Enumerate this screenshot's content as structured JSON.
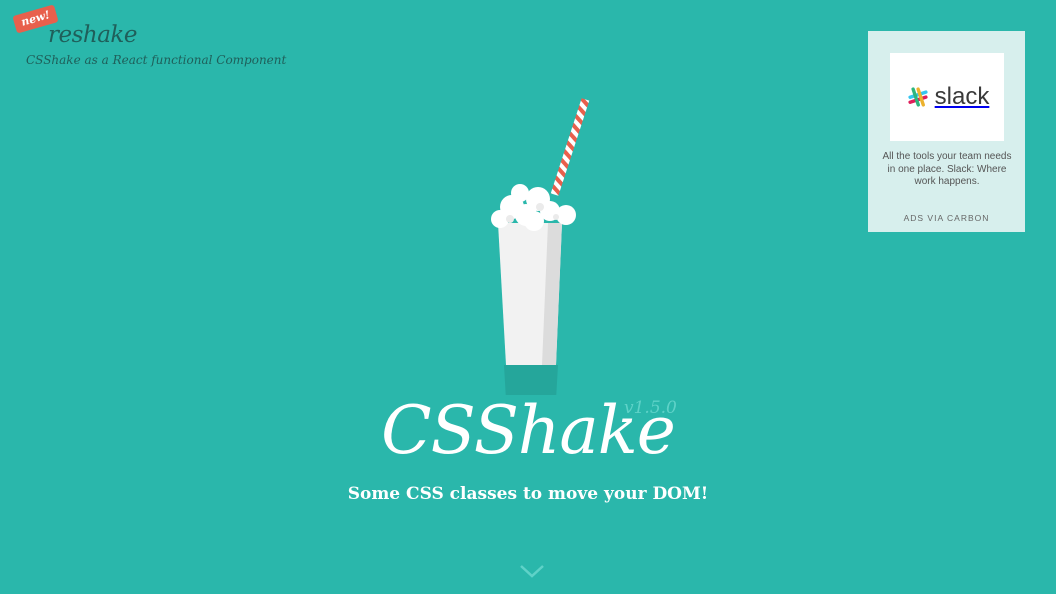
{
  "reshake": {
    "badge": "new!",
    "title": "reshake",
    "subtitle": "CSShake as a React functional Component"
  },
  "ad": {
    "brand": "slack",
    "text": "All the tools your team needs in one place. Slack: Where work happens.",
    "powered_by": "ADS VIA CARBON"
  },
  "hero": {
    "title": "CSShake",
    "version": "v1.5.0",
    "subtitle": "Some CSS classes to move your DOM!"
  },
  "icons": {
    "scroll": "chevron-down-icon",
    "logo": "slack-logo-icon",
    "illustration": "milkshake-icon"
  },
  "colors": {
    "background": "#2ab7ab",
    "badge": "#e8604c",
    "straw": "#e8604c"
  }
}
